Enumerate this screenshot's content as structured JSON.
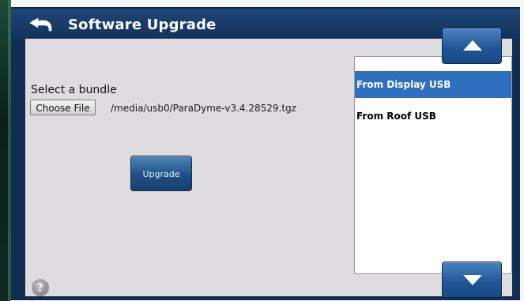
{
  "header": {
    "title": "Software Upgrade",
    "back_icon": "back-arrow-icon"
  },
  "main": {
    "select_label": "Select a bundle",
    "choose_file_label": "Choose File",
    "file_path": "/media/usb0/ParaDyme-v3.4.28529.tgz",
    "upgrade_label": "Upgrade",
    "help_icon": "?"
  },
  "source_list": {
    "items": [
      {
        "label": "From Display USB",
        "selected": true
      },
      {
        "label": "From Roof USB",
        "selected": false
      }
    ],
    "scroll_up_icon": "up-arrow-icon",
    "scroll_down_icon": "down-arrow-icon"
  },
  "colors": {
    "header_bg": "#13325c",
    "panel_bg": "#dedcdf",
    "selected_item": "#2f6fc0",
    "button_blue": "#1f5596"
  }
}
